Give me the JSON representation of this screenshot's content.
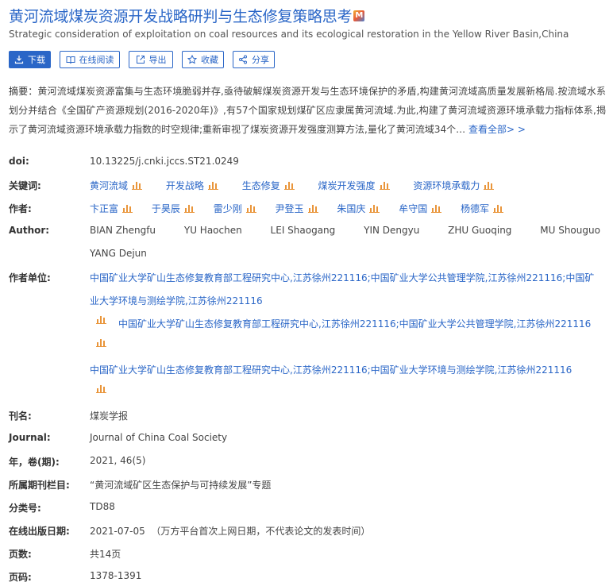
{
  "title": "黄河流域煤炭资源开发战略研判与生态修复策略思考",
  "title_badge": "M",
  "subtitle": "Strategic consideration of exploitation on coal resources and its ecological restoration in the Yellow River Basin,China",
  "toolbar": {
    "download": "下载",
    "read_online": "在线阅读",
    "export": "导出",
    "favorite": "收藏",
    "share": "分享"
  },
  "abstract": {
    "label": "摘要：",
    "text": "黄河流域煤炭资源富集与生态环境脆弱并存,亟待破解煤炭资源开发与生态环境保护的矛盾,构建黄河流域高质量发展新格局.按流域水系划分并结合《全国矿产资源规划(2016-2020年)》,有57个国家规划煤矿区应隶属黄河流域.为此,构建了黄河流域资源环境承载力指标体系,揭示了黄河流域资源环境承载力指数的时空规律;重新审视了煤炭资源开发强度测算方法,量化了黄河流域34个…",
    "more": "查看全部> >"
  },
  "fields": {
    "doi_label": "doi:",
    "doi": "10.13225/j.cnki.jccs.ST21.0249",
    "keywords_label": "关键词:",
    "keywords": [
      "黄河流域",
      "开发战略",
      "生态修复",
      "煤炭开发强度",
      "资源环境承载力"
    ],
    "authors_label": "作者:",
    "authors": [
      "卞正富",
      "于昊辰",
      "雷少刚",
      "尹登玉",
      "朱国庆",
      "牟守国",
      "杨德军"
    ],
    "author_en_label": "Author:",
    "authors_en": [
      "BIAN Zhengfu",
      "YU Haochen",
      "LEI Shaogang",
      "YIN Dengyu",
      "ZHU Guoqing",
      "MU Shouguo",
      "YANG Dejun"
    ],
    "affiliation_label": "作者单位:",
    "affiliation_main_1": "中国矿业大学矿山生态修复教育部工程研究中心,江苏徐州221116;中国矿业大学公共管理学院,江苏徐州221116;中国矿",
    "affiliation_main_2": "业大学环境与测绘学院,江苏徐州221116",
    "affiliation_b": "中国矿业大学矿山生态修复教育部工程研究中心,江苏徐州221116;中国矿业大学公共管理学院,江苏徐州221116",
    "affiliation_c": "中国矿业大学矿山生态修复教育部工程研究中心,江苏徐州221116;中国矿业大学环境与测绘学院,江苏徐州221116",
    "journal_cn_label": "刊名:",
    "journal_cn": "煤炭学报",
    "journal_en_label": "Journal:",
    "journal_en": "Journal of China Coal Society",
    "year_label": "年，卷(期):",
    "year": "2021, 46(5)",
    "column_label": "所属期刊栏目:",
    "column": "“黄河流域矿区生态保护与可持续发展”专题",
    "class_label": "分类号:",
    "class": "TD88",
    "online_date_label": "在线出版日期:",
    "online_date": "2021-07-05",
    "online_date_note": "（万方平台首次上网日期，不代表论文的发表时间）",
    "pages_label": "页数:",
    "pages": "共14页",
    "page_range_label": "页码:",
    "page_range": "1378-1391"
  }
}
